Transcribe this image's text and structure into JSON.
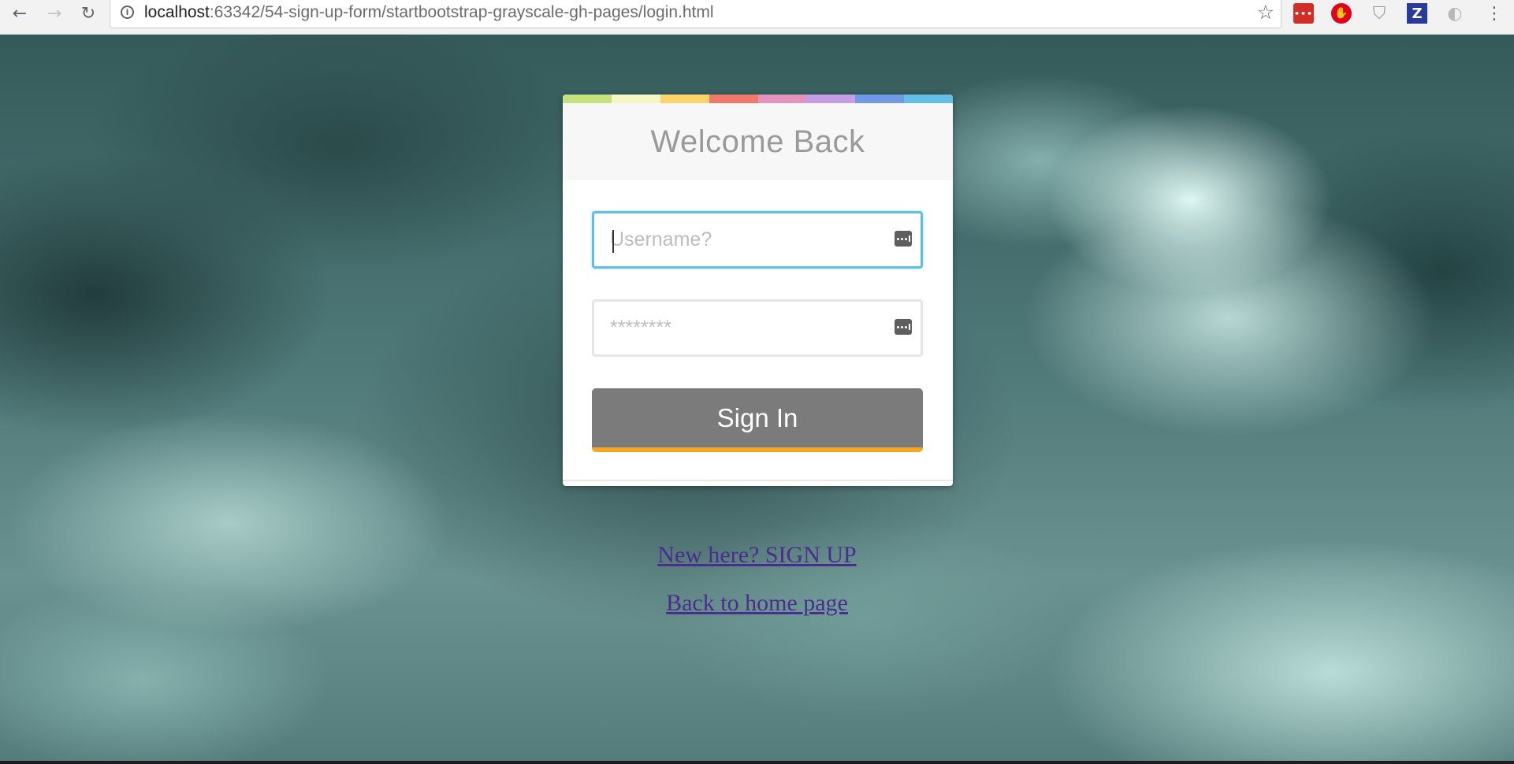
{
  "browser": {
    "url_host": "localhost",
    "url_rest": ":63342/54-sign-up-form/startbootstrap-grayscale-gh-pages/login.html",
    "icons": {
      "back": "arrow-left-icon",
      "forward": "arrow-right-icon",
      "reload": "reload-icon",
      "info": "info-icon",
      "bookmark": "star-icon",
      "menu": "kebab-menu-icon"
    },
    "extensions": [
      {
        "name": "lastpass-icon",
        "glyph": "•••"
      },
      {
        "name": "adblock-icon",
        "glyph": "✋"
      },
      {
        "name": "shield-icon",
        "glyph": "⛉"
      },
      {
        "name": "zotero-icon",
        "glyph": "Z"
      },
      {
        "name": "extension-icon",
        "glyph": "◐"
      }
    ]
  },
  "login": {
    "title": "Welcome Back",
    "username_placeholder": "Username?",
    "password_placeholder": "********",
    "signin_label": "Sign In",
    "accent_colors": [
      "#c6e07e",
      "#f4f7c4",
      "#fdd36b",
      "#ef7a6b",
      "#e394be",
      "#c39ee5",
      "#6f99e4",
      "#63bfe6"
    ],
    "button_color": "#7b7b7b",
    "button_accent": "#f5a623",
    "focus_color": "#61bfe3"
  },
  "links": {
    "signup": "New here? SIGN UP",
    "home": "Back to home page"
  }
}
